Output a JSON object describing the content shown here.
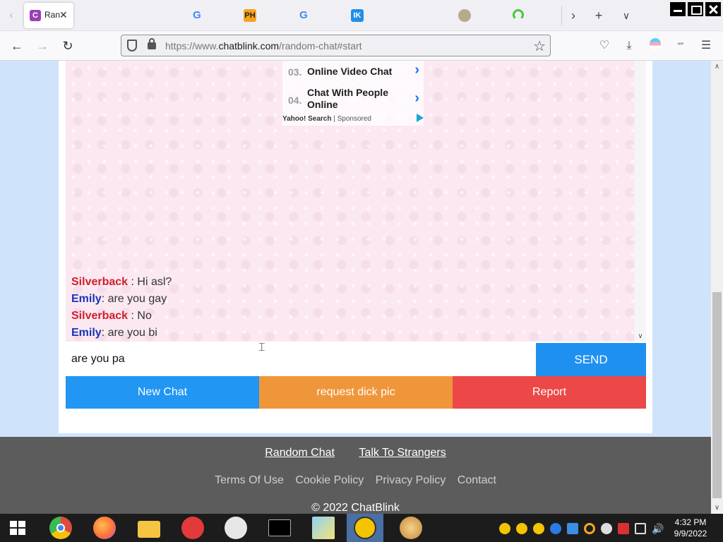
{
  "browser": {
    "active_tab_title": "Ran",
    "tab_favicons": [
      {
        "label": "G"
      },
      {
        "label": "PH"
      },
      {
        "label": "G"
      },
      {
        "label": "IK"
      }
    ],
    "url_prefix": "https://www.",
    "url_domain": "chatblink.com",
    "url_path": "/random-chat#start"
  },
  "ad": {
    "items": [
      {
        "num": "03.",
        "text": "Online Video Chat"
      },
      {
        "num": "04.",
        "text": "Chat With People Online"
      }
    ],
    "footer_brand": "Yahoo! Search",
    "footer_sep": " | ",
    "footer_sponsored": "Sponsored"
  },
  "chat": {
    "messages": [
      {
        "sender": "Silverback",
        "sep": " : ",
        "text": "Hi asl?"
      },
      {
        "sender": "Emily",
        "sep": ": ",
        "text": "are you gay"
      },
      {
        "sender": "Silverback",
        "sep": " : ",
        "text": "No"
      },
      {
        "sender": "Emily",
        "sep": ": ",
        "text": "are you bi"
      }
    ],
    "input_value": "are you pa",
    "send_label": "SEND"
  },
  "actions": {
    "new_chat": "New Chat",
    "request": "request dick pic",
    "report": "Report"
  },
  "footer": {
    "primary_links": [
      "Random Chat",
      "Talk To Strangers"
    ],
    "secondary_links": [
      "Terms Of Use",
      "Cookie Policy",
      "Privacy Policy",
      "Contact"
    ],
    "copyright": "© 2022 ChatBlink"
  },
  "taskbar": {
    "time": "4:32 PM",
    "date": "9/9/2022",
    "colors": {
      "chrome": "#dd4b3e",
      "firefox": "#ff7139",
      "explorer": "#f4c542",
      "vpn": "#f5c400"
    }
  }
}
